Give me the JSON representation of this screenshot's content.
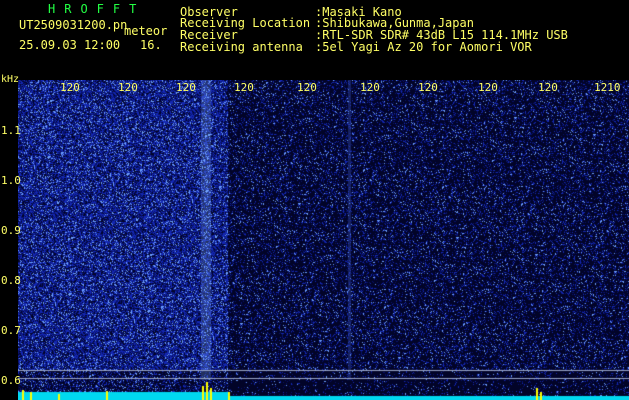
{
  "app_title": "HROFFT",
  "file_name": "UT2509031200.pn",
  "meteor_label": "meteor",
  "date_time": "25.09.03 12:00",
  "frame_no": "16.",
  "info": [
    {
      "label": "Observer",
      "value": ":Masaki Kano"
    },
    {
      "label": "Receiving Location",
      "value": ":Shibukawa,Gunma,Japan"
    },
    {
      "label": "Receiver",
      "value": ":RTL-SDR SDR# 43dB L15 114.1MHz USB"
    },
    {
      "label": "Receiving antenna",
      "value": ":5el Yagi Az 20 for Aomori VOR"
    }
  ],
  "axis": {
    "y_unit": "kHz",
    "y_ticks": [
      "1.1",
      "1.0",
      "0.9",
      "0.8",
      "0.7",
      "0.6"
    ],
    "x_ticks": [
      "120",
      "120",
      "120",
      "120",
      "120",
      "120",
      "120",
      "120",
      "120",
      "1210"
    ]
  },
  "colors": {
    "background": "#000000",
    "text": "#ffff66",
    "title": "#22ff44",
    "noise_low": "#0a1a8c",
    "noise_high": "#6fa0ff",
    "baseline": "#00e5ff",
    "spike": "#ffff00"
  }
}
